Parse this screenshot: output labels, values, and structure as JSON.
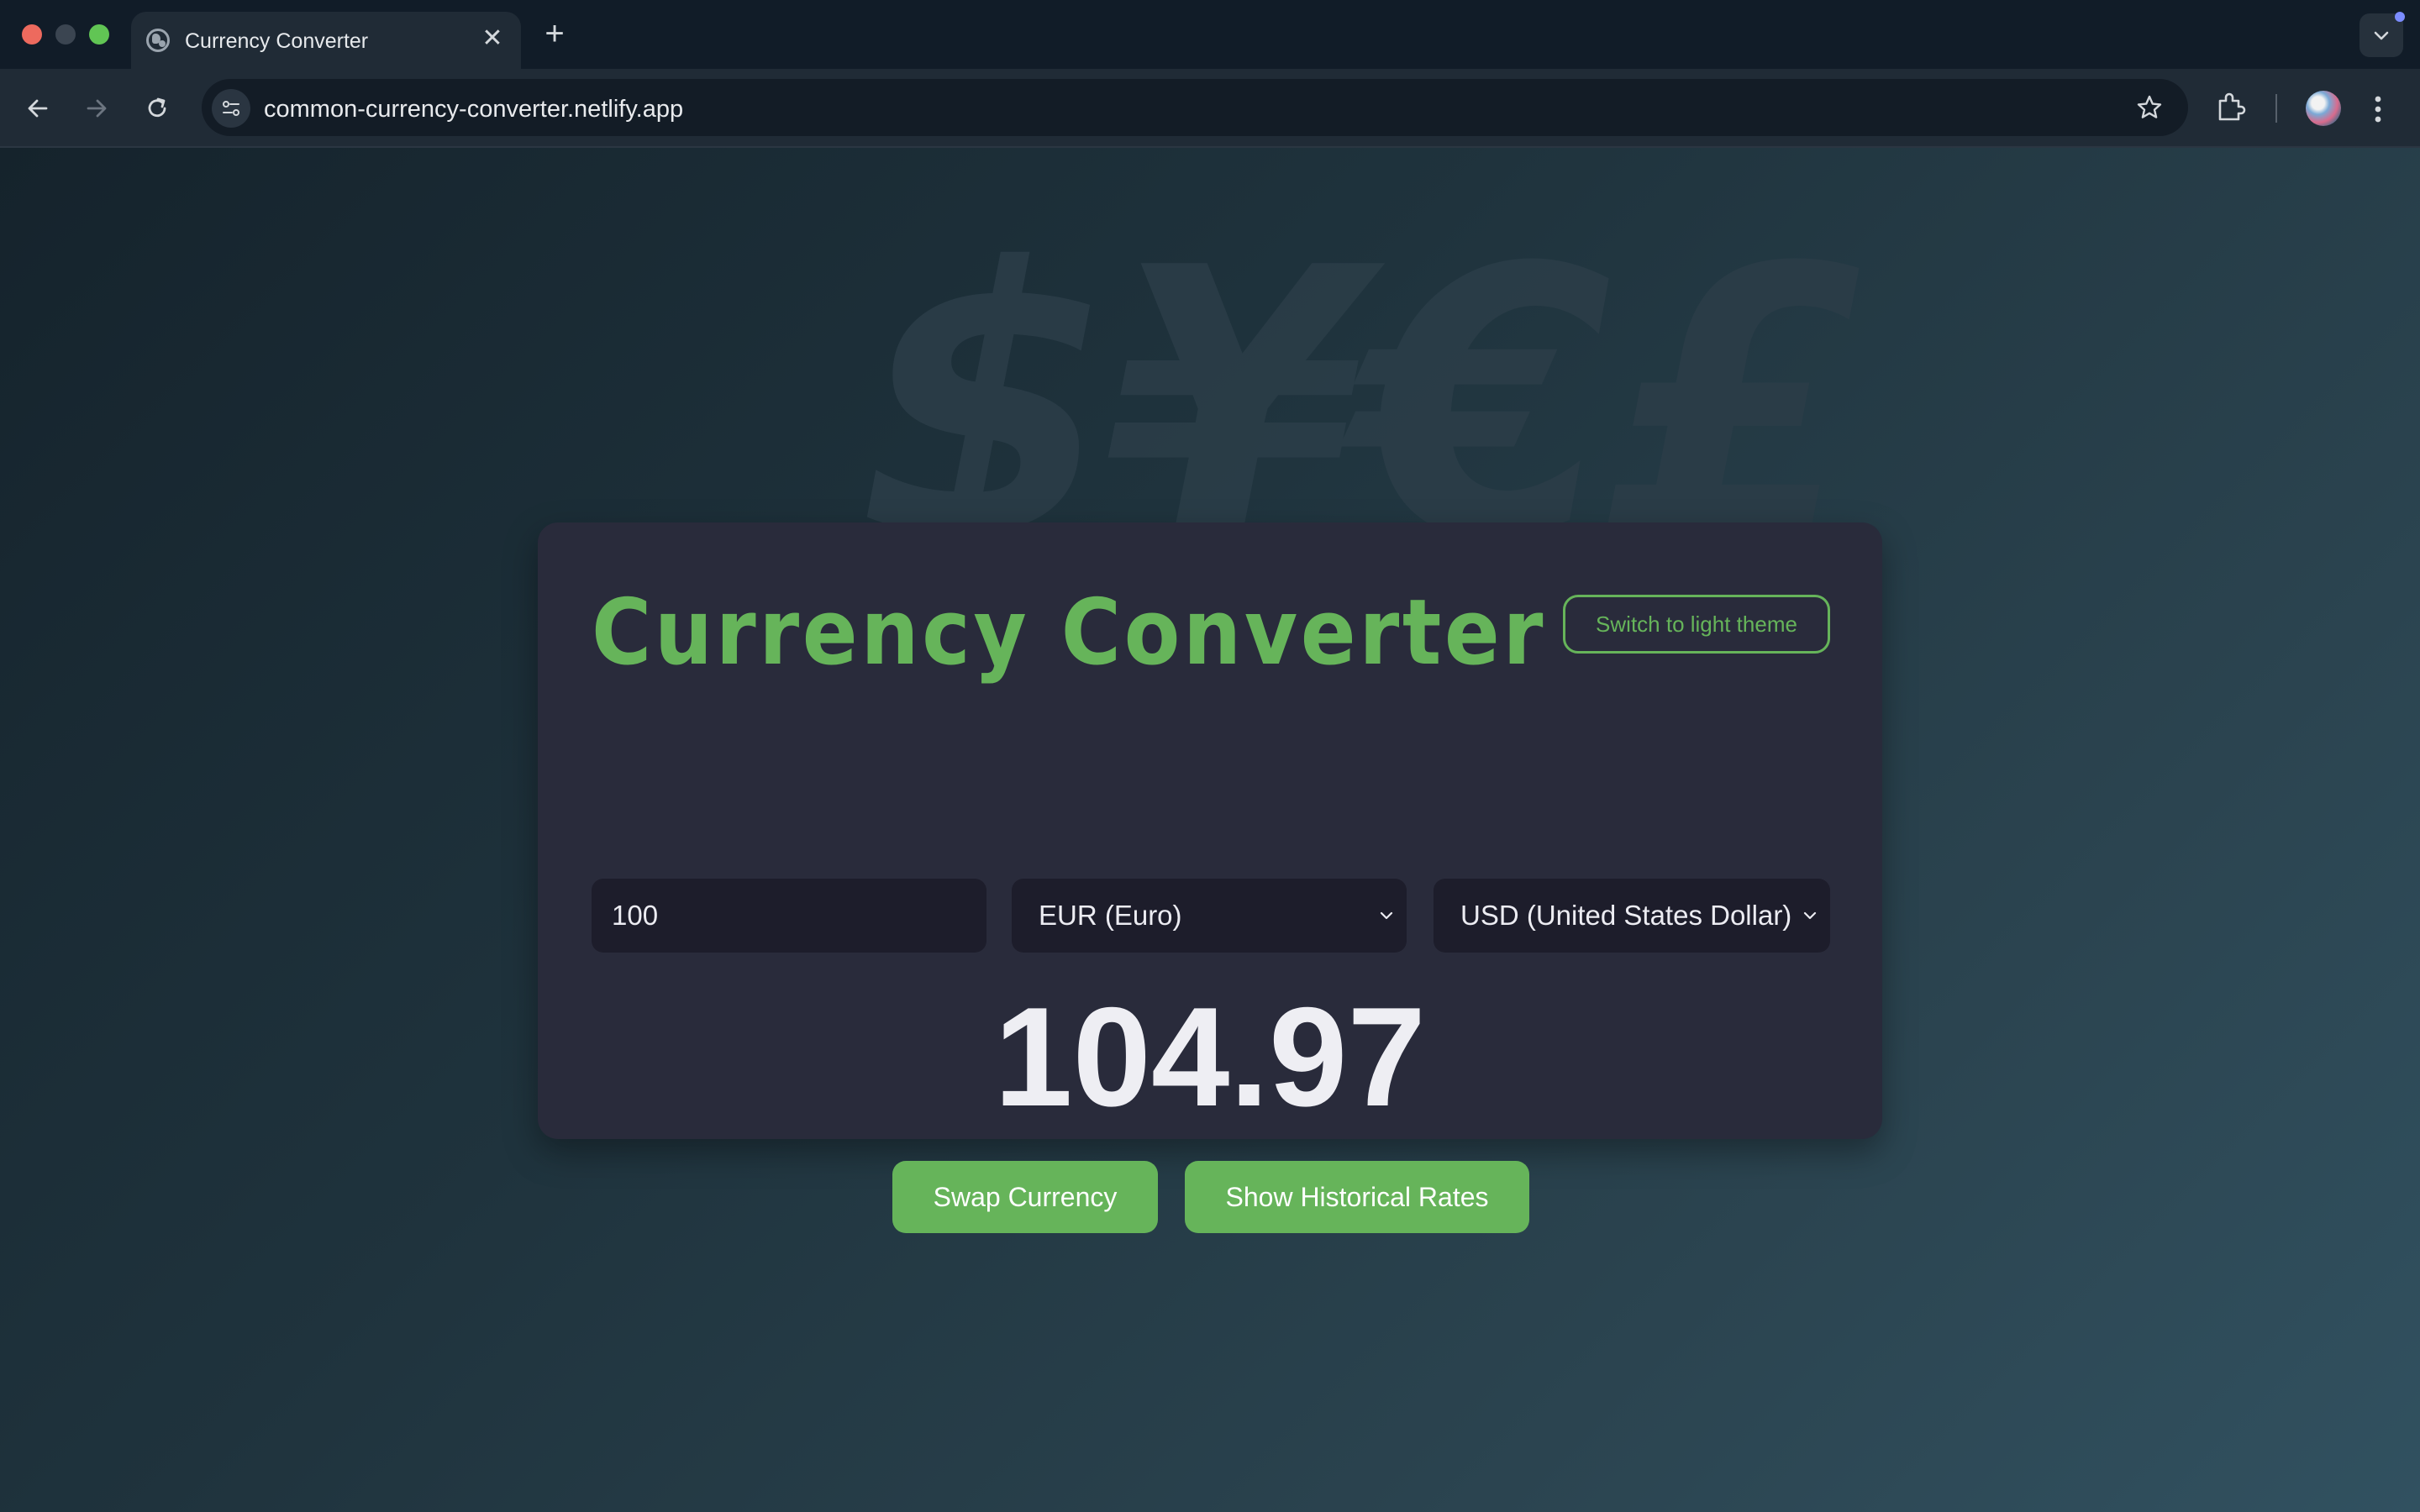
{
  "browser": {
    "tab_title": "Currency Converter",
    "tab_close_glyph": "✕",
    "new_tab_glyph": "+",
    "url": "common-currency-converter.netlify.app"
  },
  "background": {
    "symbols": "$¥€£"
  },
  "app": {
    "title": "Currency Converter",
    "theme_toggle_label": "Switch to light theme",
    "amount_value": "100",
    "from_currency": "EUR (Euro)",
    "to_currency": "USD (United States Dollar)",
    "result": "104.97",
    "swap_label": "Swap Currency",
    "historical_label": "Show Historical Rates"
  },
  "colors": {
    "accent": "#66b45a",
    "card_bg": "#292b3b",
    "field_bg": "#1d1d2b"
  },
  "icons": [
    "globe-icon",
    "close-icon",
    "plus-icon",
    "chevron-down-icon",
    "back-arrow-icon",
    "forward-arrow-icon",
    "reload-icon",
    "site-settings-icon",
    "bookmark-star-icon",
    "extensions-icon",
    "profile-avatar",
    "more-menu-icon"
  ]
}
